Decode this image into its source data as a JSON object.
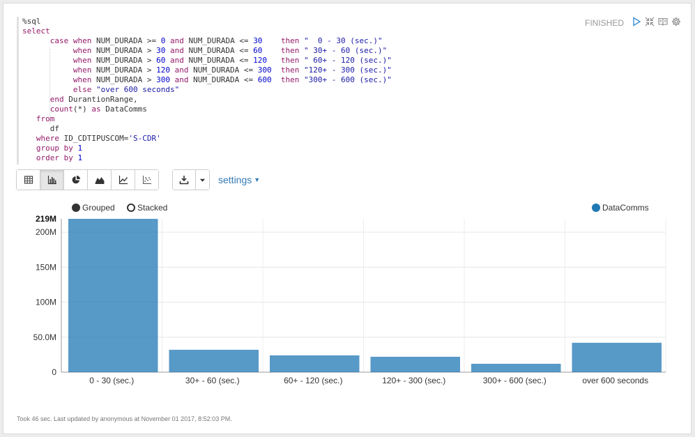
{
  "status": "FINISHED",
  "icons": {
    "run": "play-icon",
    "hide_editor": "collapse-icon",
    "hide_output": "book-icon",
    "settings": "gear-icon"
  },
  "code_lines": [
    "%sql",
    "select",
    "      case when NUM_DURADA >= 0 and NUM_DURADA <= 30    then \"  0 - 30 (sec.)\"",
    "           when NUM_DURADA > 30 and NUM_DURADA <= 60    then \" 30+ - 60 (sec.)\"",
    "           when NUM_DURADA > 60 and NUM_DURADA <= 120   then \" 60+ - 120 (sec.)\"",
    "           when NUM_DURADA > 120 and NUM_DURADA <= 300  then \"120+ - 300 (sec.)\"",
    "           when NUM_DURADA > 300 and NUM_DURADA <= 600  then \"300+ - 600 (sec.)\"",
    "           else \"over 600 seconds\"",
    "      end DurantionRange,",
    "      count(*) as DataComms",
    "   from",
    "      df",
    "   where ID_CDTIPUSCOM='S-CDR'",
    "   group by 1",
    "   order by 1"
  ],
  "toolbar": {
    "views": [
      "table-icon",
      "bar-chart-icon",
      "pie-chart-icon",
      "area-chart-icon",
      "line-chart-icon",
      "scatter-chart-icon"
    ],
    "active_view": 1,
    "download_icon": "download-icon",
    "settings_label": "settings"
  },
  "chart_options": {
    "grouped_label": "Grouped",
    "stacked_label": "Stacked",
    "selected": "grouped"
  },
  "chart_data": {
    "type": "bar",
    "categories": [
      "0 - 30 (sec.)",
      "30+ - 60 (sec.)",
      "60+ - 120 (sec.)",
      "120+ - 300 (sec.)",
      "300+ - 600 (sec.)",
      "over 600 seconds"
    ],
    "series": [
      {
        "name": "DataComms",
        "color": "#1f77b4",
        "values": [
          219000000,
          32000000,
          24000000,
          22000000,
          12000000,
          42000000
        ]
      }
    ],
    "ylim": [
      0,
      219000000
    ],
    "y_ticks": [
      0,
      50000000,
      100000000,
      150000000,
      200000000
    ],
    "y_tick_labels": [
      "0",
      "50.0M",
      "100M",
      "150M",
      "200M"
    ],
    "y_max_label": "219M",
    "grid": true,
    "legend_position": "top-right"
  },
  "footer": "Took 46 sec. Last updated by anonymous at November 01 2017, 8:52:03 PM."
}
